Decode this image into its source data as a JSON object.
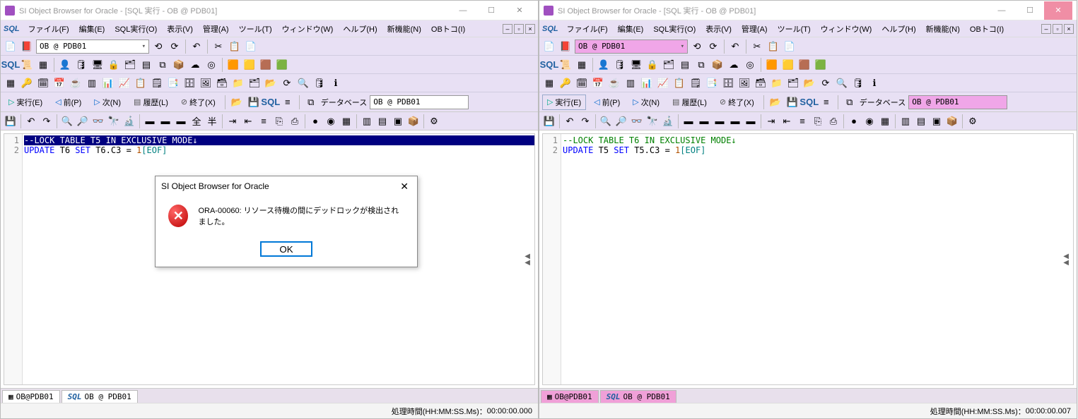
{
  "left": {
    "title": "SI Object Browser for Oracle - [SQL 実行 - OB @ PDB01]",
    "menus": [
      "ファイル(F)",
      "編集(E)",
      "SQL実行(O)",
      "表示(V)",
      "管理(A)",
      "ツール(T)",
      "ウィンドウ(W)",
      "ヘルプ(H)",
      "新機能(N)",
      "OBトコ(I)"
    ],
    "connection": "OB @ PDB01",
    "actions": {
      "exec": "実行(E)",
      "prev": "前(P)",
      "next": "次(N)",
      "hist": "履歴(L)",
      "end": "終了(X)",
      "dblabel": "データベース",
      "db": "OB @ PDB01"
    },
    "code": {
      "l1": "--LOCK TABLE T5 IN EXCLUSIVE MODE↓",
      "l2_update": "UPDATE",
      "l2_t6": "T6",
      "l2_set": "SET",
      "l2_col": "T6.C3",
      "l2_eq": "=",
      "l2_val": "1",
      "l2_eof": "[EOF]"
    },
    "tabs": {
      "t1": "OB@PDB01",
      "t2": "OB @ PDB01"
    },
    "status": {
      "label": "処理時間(HH:MM:SS.Ms)：",
      "val": "00:00:00.000"
    },
    "dialog": {
      "title": "SI Object Browser for Oracle",
      "msg": "ORA-00060: リソース待機の間にデッドロックが検出されました。",
      "ok": "OK"
    }
  },
  "right": {
    "title": "SI Object Browser for Oracle - [SQL 実行 - OB @ PDB01]",
    "menus": [
      "ファイル(F)",
      "編集(E)",
      "SQL実行(O)",
      "表示(V)",
      "管理(A)",
      "ツール(T)",
      "ウィンドウ(W)",
      "ヘルプ(H)",
      "新機能(N)",
      "OBトコ(I)"
    ],
    "connection": "OB @ PDB01",
    "actions": {
      "exec": "実行(E)",
      "prev": "前(P)",
      "next": "次(N)",
      "hist": "履歴(L)",
      "end": "終了(X)",
      "dblabel": "データベース",
      "db": "OB @ PDB01"
    },
    "code": {
      "l1": "--LOCK TABLE T6 IN EXCLUSIVE MODE↓",
      "l2_update": "UPDATE",
      "l2_t5": "T5",
      "l2_set": "SET",
      "l2_col": "T5.C3",
      "l2_eq": "=",
      "l2_val": "1",
      "l2_eof": "[EOF]"
    },
    "tabs": {
      "t1": "OB@PDB01",
      "t2": "OB @ PDB01"
    },
    "status": {
      "label": "処理時間(HH:MM:SS.Ms)：",
      "val": "00:00:00.007"
    }
  }
}
